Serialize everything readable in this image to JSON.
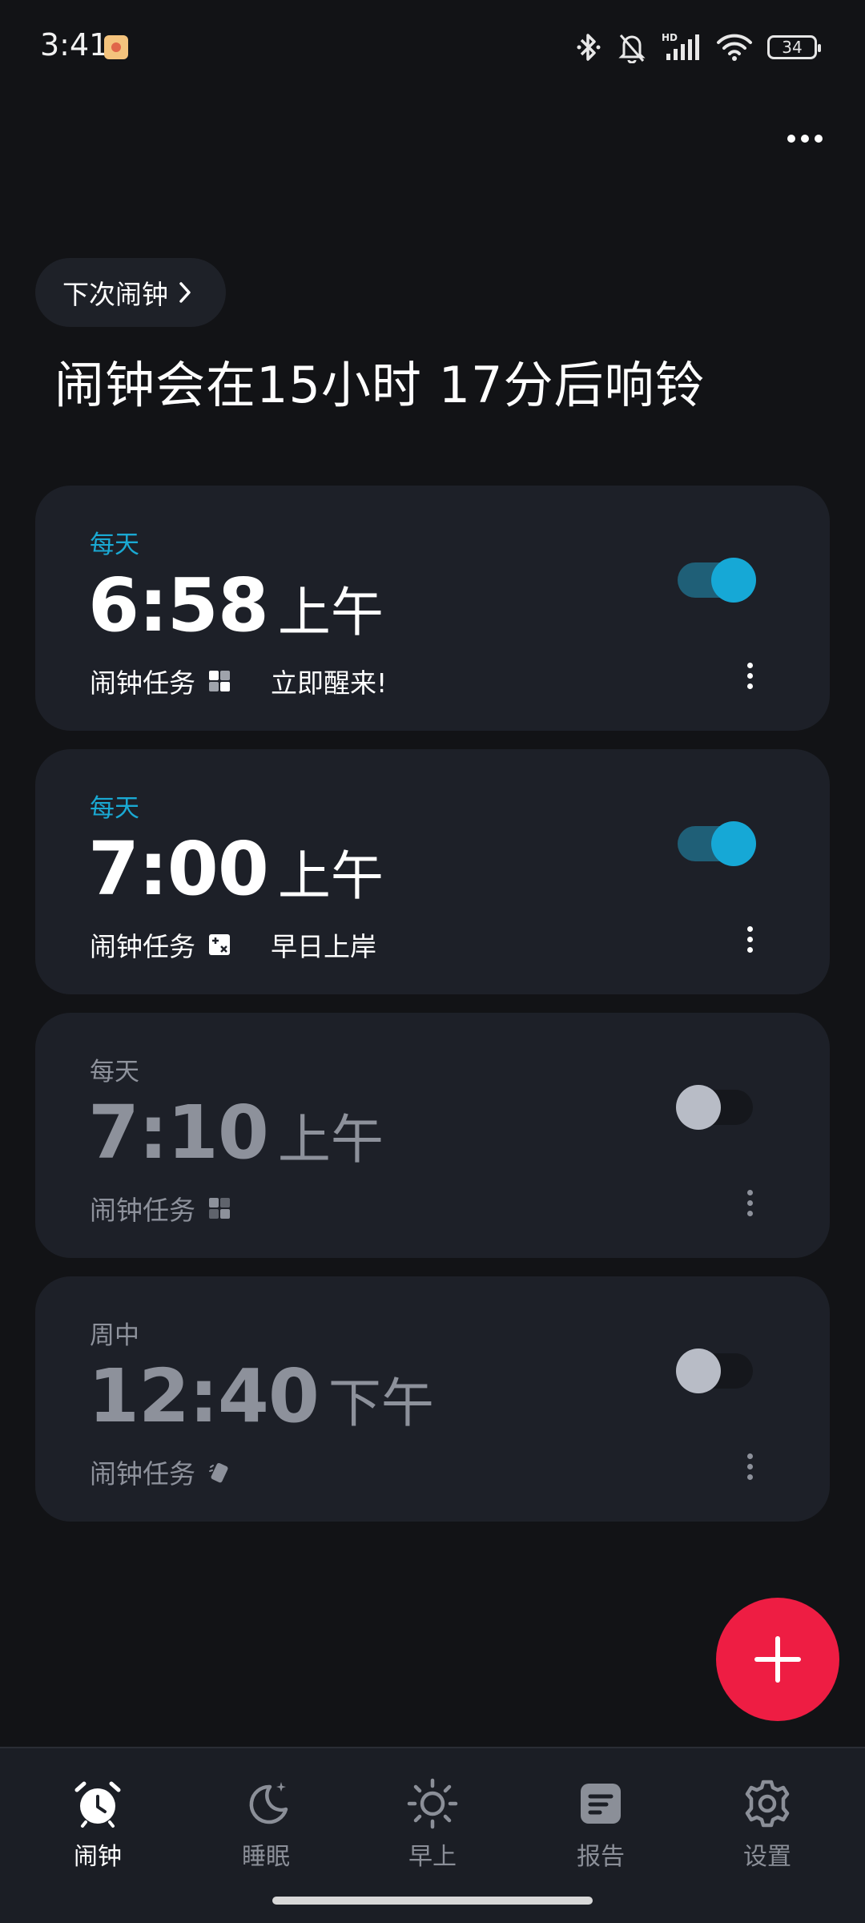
{
  "status_bar": {
    "time": "3:41",
    "battery": "34",
    "icons": [
      "bluetooth-icon",
      "bell-muted-icon",
      "hd-signal-icon",
      "wifi-icon",
      "battery-icon"
    ]
  },
  "header": {
    "next_alarm_chip": "下次闹钟",
    "headline": "闹钟会在15小时 17分后响铃"
  },
  "alarms": [
    {
      "repeat": "每天",
      "time": "6:58",
      "period": "上午",
      "task_label": "闹钟任务",
      "task_icon": "grid-icon",
      "note": "立即醒来!",
      "enabled": true
    },
    {
      "repeat": "每天",
      "time": "7:00",
      "period": "上午",
      "task_label": "闹钟任务",
      "task_icon": "math-icon",
      "note": "早日上岸",
      "enabled": true
    },
    {
      "repeat": "每天",
      "time": "7:10",
      "period": "上午",
      "task_label": "闹钟任务",
      "task_icon": "grid-icon",
      "note": "",
      "enabled": false
    },
    {
      "repeat": "周中",
      "time": "12:40",
      "period": "下午",
      "task_label": "闹钟任务",
      "task_icon": "shake-phone-icon",
      "note": "",
      "enabled": false
    }
  ],
  "nav": {
    "items": [
      {
        "label": "闹钟",
        "icon": "alarm-clock-icon",
        "selected": true
      },
      {
        "label": "睡眠",
        "icon": "moon-icon",
        "selected": false
      },
      {
        "label": "早上",
        "icon": "sun-icon",
        "selected": false
      },
      {
        "label": "报告",
        "icon": "report-icon",
        "selected": false
      },
      {
        "label": "设置",
        "icon": "gear-icon",
        "selected": false
      }
    ]
  },
  "colors": {
    "background": "#121316",
    "card": "#1d2028",
    "accent": "#1aa9d3",
    "fab": "#ee1d43",
    "inactive_text": "#8d919b"
  }
}
